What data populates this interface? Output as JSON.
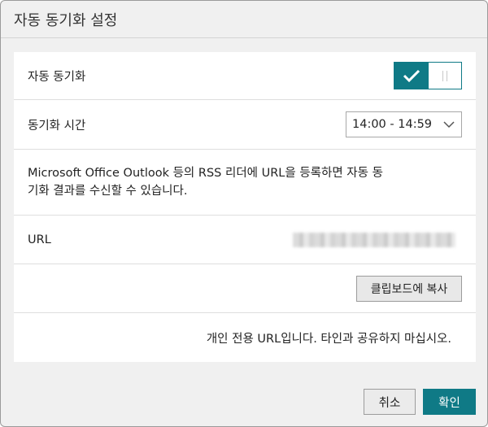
{
  "dialog": {
    "title": "자동 동기화 설정"
  },
  "auto_sync": {
    "label": "자동 동기화",
    "enabled": true
  },
  "sync_time": {
    "label": "동기화 시간",
    "selected": "14:00 - 14:59"
  },
  "description": {
    "line1": "Microsoft Office Outlook 등의 RSS 리더에 URL을 등록하면 자동 동",
    "line2": "기화 결과를 수신할 수 있습니다."
  },
  "url": {
    "label": "URL"
  },
  "copy_button": {
    "label": "클립보드에 복사"
  },
  "private_note": {
    "text": "개인 전용 URL입니다. 타인과 공유하지 마십시오."
  },
  "footer": {
    "cancel_label": "취소",
    "ok_label": "확인"
  },
  "colors": {
    "accent": "#0f7a86"
  }
}
